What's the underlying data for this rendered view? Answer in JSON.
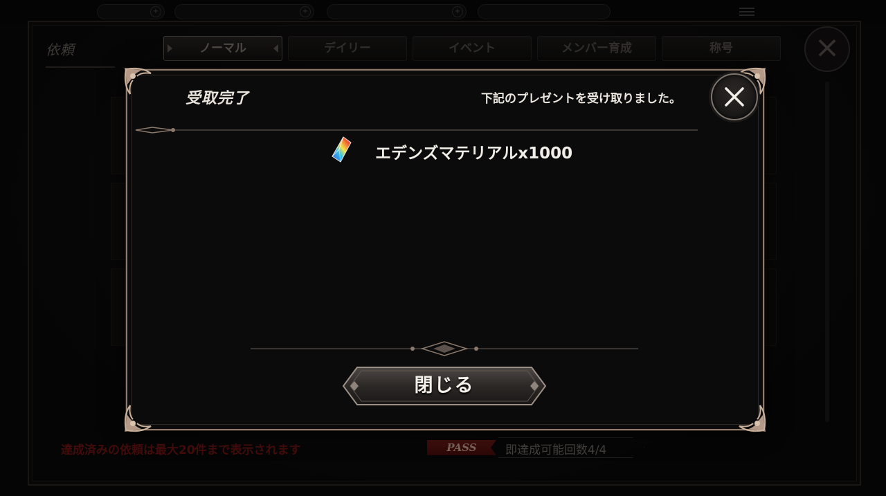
{
  "background": {
    "screen_title": "依頼",
    "tabs": [
      {
        "label": "ノーマル",
        "active": true
      },
      {
        "label": "デイリー",
        "active": false
      },
      {
        "label": "イベント",
        "active": false
      },
      {
        "label": "メンバー育成",
        "active": false
      },
      {
        "label": "称号",
        "active": false
      }
    ],
    "notice": "達成済みの依頼は最大20件まで表示されます",
    "pass_badge": "PASS",
    "pass_text": "即達成可能回数4/4"
  },
  "modal": {
    "title": "受取完了",
    "description": "下記のプレゼントを受け取りました。",
    "reward": {
      "icon": "rainbow-crystal-icon",
      "text": "エデンズマテリアルx1000"
    },
    "close_button_label": "閉じる"
  },
  "colors": {
    "frame": "#8f7a6c",
    "modal_bg": "#0c0b0b",
    "notice_red": "#7a1614",
    "pass_red": "#7a1e18"
  }
}
